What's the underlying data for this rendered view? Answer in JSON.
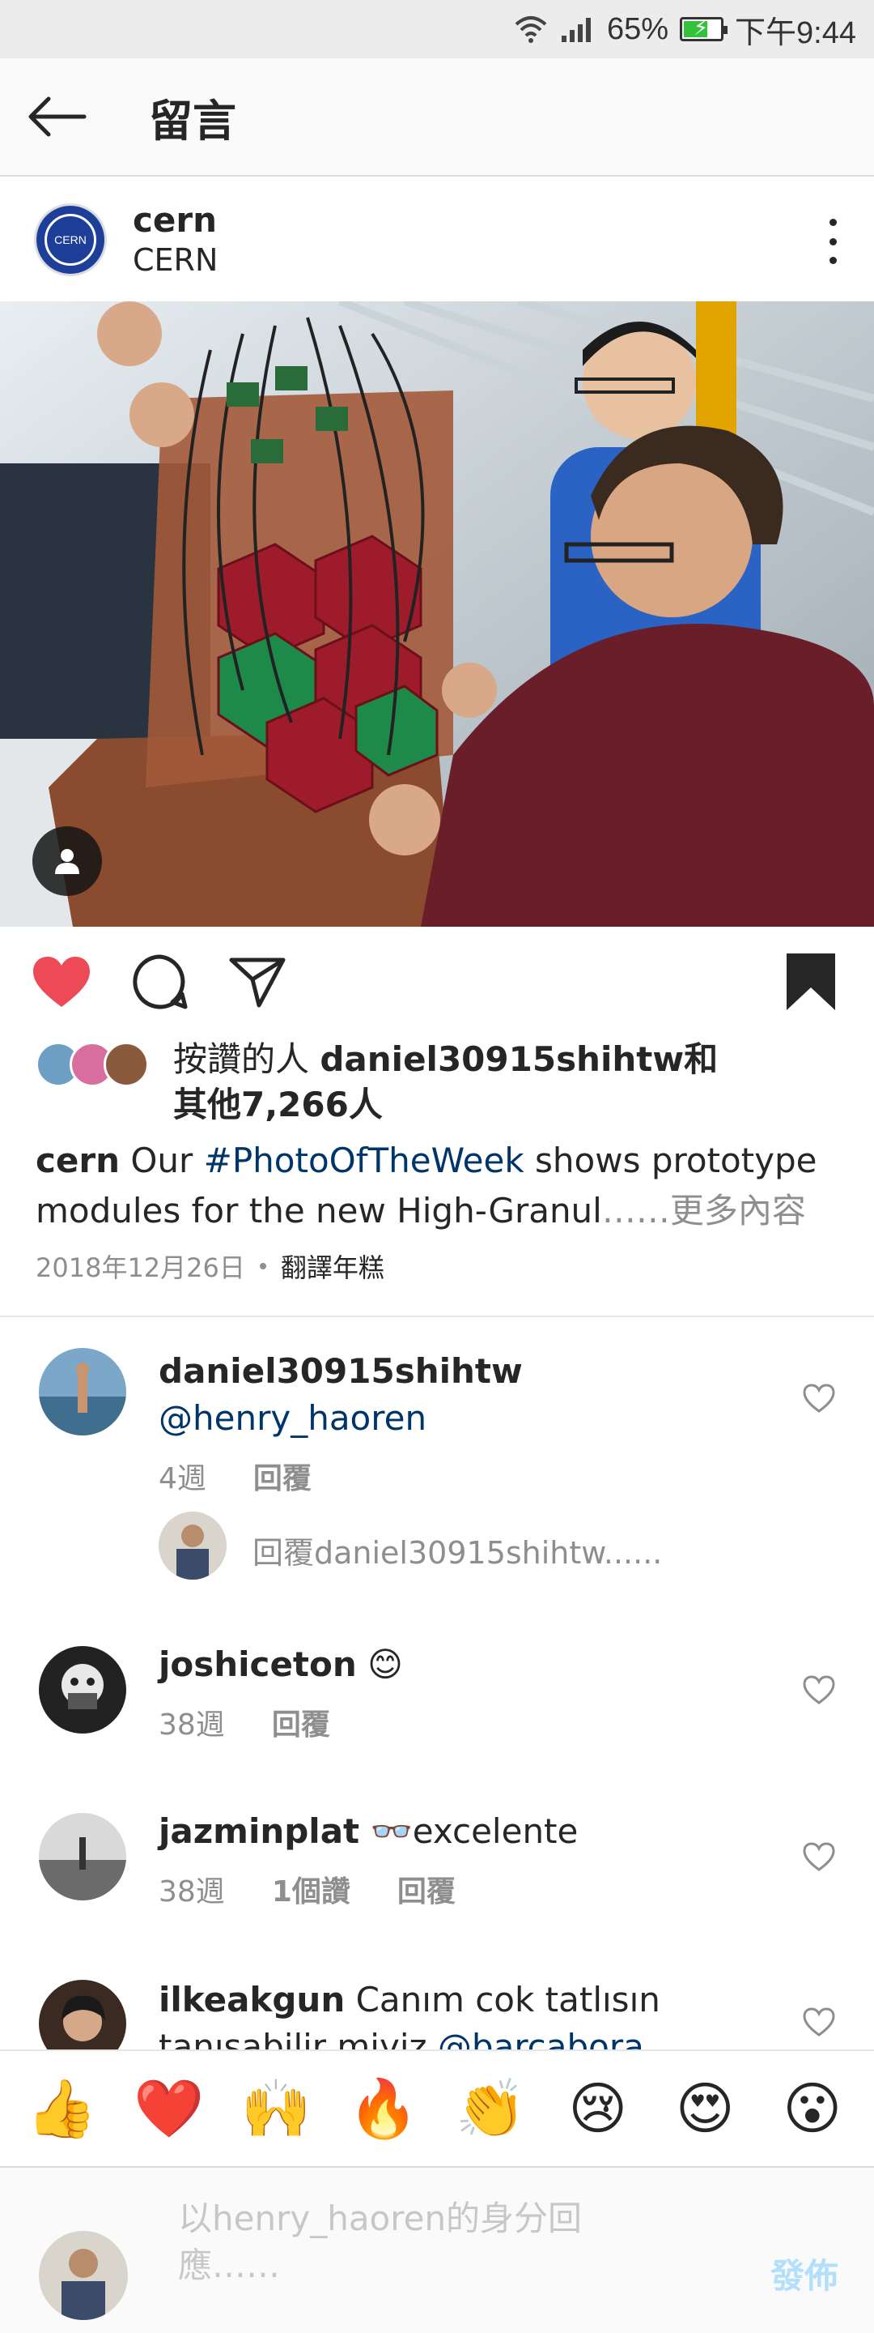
{
  "status_bar": {
    "battery": "65%",
    "battery_level": 0.65,
    "time": "下午9:44",
    "icons": [
      "wifi-icon",
      "signal-icon",
      "battery-charging-icon"
    ]
  },
  "header": {
    "title": "留言",
    "back_icon": "arrow-left-icon"
  },
  "post": {
    "author": {
      "username": "cern",
      "display_name": "CERN",
      "avatar_text": "CERN"
    },
    "more_icon": "vertical-dots-icon",
    "actions": {
      "like_icon": "heart-filled-icon",
      "comment_icon": "comment-bubble-icon",
      "share_icon": "paper-plane-icon",
      "save_icon": "bookmark-filled-icon"
    },
    "likes": {
      "prefix": "按讚的人 ",
      "user": "daniel30915shihtw",
      "suffix": "和",
      "others": "其他7,266人"
    },
    "caption": {
      "username": "cern",
      "pre": " Our ",
      "hashtag": "#PhotoOfTheWeek",
      "text": " shows prototype modules for the new High-Granul",
      "more": "……更多內容"
    },
    "date": "2018年12月26日",
    "translate": "翻譯年糕"
  },
  "comments": [
    {
      "username": "daniel30915shihtw",
      "text": "",
      "mention": "@henry_haoren",
      "time": "4週",
      "likes": "",
      "reply_label": "回覆"
    },
    {
      "username": "joshiceton",
      "text": "😊",
      "mention": "",
      "time": "38週",
      "likes": "",
      "reply_label": "回覆"
    },
    {
      "username": "jazminplat",
      "text": "👓excelente",
      "mention": "",
      "time": "38週",
      "likes": "1個讚",
      "reply_label": "回覆"
    },
    {
      "username": "ilkeakgun",
      "text": "Canım cok tatlısın tanışabilir miyiz",
      "mention": "@barcabora",
      "time": "",
      "likes": "",
      "reply_label": ""
    }
  ],
  "reply_thread": {
    "text": "回覆daniel30915shihtw......"
  },
  "emoji_bar": [
    "👍",
    "❤️",
    "🙌",
    "🔥",
    "👏",
    "😢",
    "😍",
    "😮"
  ],
  "composer": {
    "placeholder": "以henry_haoren的身分回應……",
    "post_label": "發佈"
  },
  "colors": {
    "heart_red": "#ed4956",
    "link_blue": "#003569",
    "muted_gray": "#8e8e8e",
    "post_button_disabled": "#b2dffc",
    "cern_blue": "#1d3f9a"
  }
}
